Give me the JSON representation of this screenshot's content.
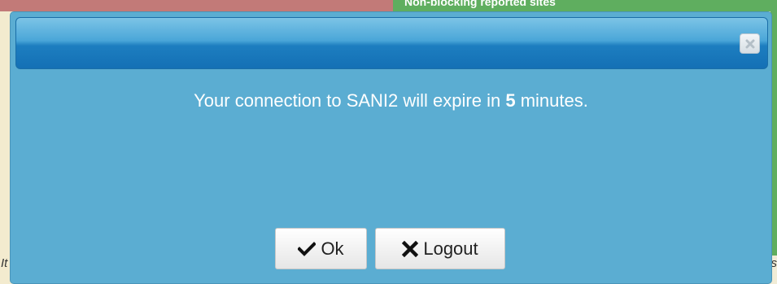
{
  "background": {
    "top_banner_text": "Non-blocking reported sites",
    "left_edge_text": "It",
    "right_edge_text": "s"
  },
  "dialog": {
    "close_icon": "close-icon",
    "message": {
      "prefix": "Your connection to SANI2 will expire in ",
      "minutes": "5",
      "suffix": " minutes."
    },
    "buttons": {
      "ok": {
        "label": "Ok",
        "icon": "checkmark-icon"
      },
      "logout": {
        "label": "Logout",
        "icon": "x-icon"
      }
    }
  },
  "colors": {
    "dialog_background": "#5badd2",
    "header_dark": "#1470b5",
    "header_light": "#7cc4e6",
    "message_text": "#ffffff"
  }
}
